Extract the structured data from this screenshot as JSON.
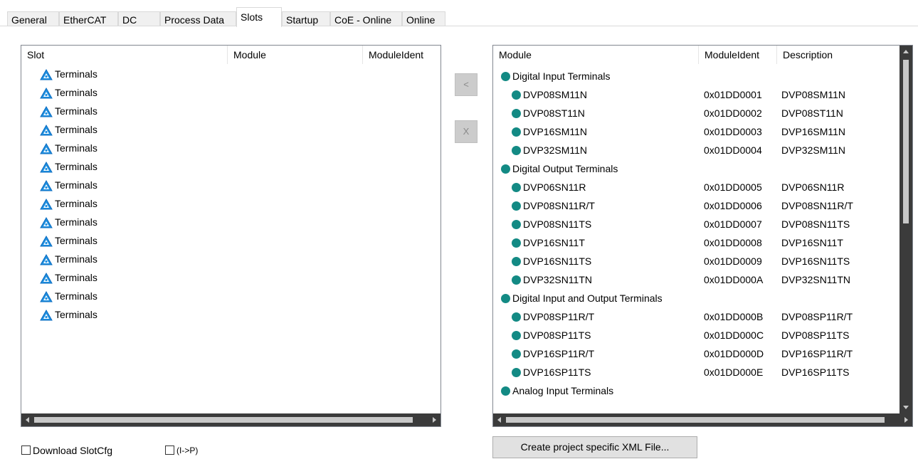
{
  "tabs": [
    "General",
    "EtherCAT",
    "DC",
    "Process Data",
    "Slots",
    "Startup",
    "CoE - Online",
    "Online"
  ],
  "active_tab": "Slots",
  "slot_table": {
    "headers": [
      "Slot",
      "Module",
      "ModuleIdent"
    ],
    "rows": [
      "Terminals",
      "Terminals",
      "Terminals",
      "Terminals",
      "Terminals",
      "Terminals",
      "Terminals",
      "Terminals",
      "Terminals",
      "Terminals",
      "Terminals",
      "Terminals",
      "Terminals",
      "Terminals"
    ],
    "row_icon": "warning-triangle-icon"
  },
  "buttons": {
    "insert": "<",
    "remove": "X",
    "create_xml": "Create project specific XML File..."
  },
  "module_table": {
    "headers": [
      "Module",
      "ModuleIdent",
      "Description"
    ],
    "rows": [
      {
        "name": "Digital Input Terminals",
        "ident": "",
        "desc": "",
        "group": true
      },
      {
        "name": "DVP08SM11N",
        "ident": "0x01DD0001",
        "desc": "DVP08SM11N",
        "group": false
      },
      {
        "name": "DVP08ST11N",
        "ident": "0x01DD0002",
        "desc": "DVP08ST11N",
        "group": false
      },
      {
        "name": "DVP16SM11N",
        "ident": "0x01DD0003",
        "desc": "DVP16SM11N",
        "group": false
      },
      {
        "name": "DVP32SM11N",
        "ident": "0x01DD0004",
        "desc": "DVP32SM11N",
        "group": false
      },
      {
        "name": "Digital Output Terminals",
        "ident": "",
        "desc": "",
        "group": true
      },
      {
        "name": "DVP06SN11R",
        "ident": "0x01DD0005",
        "desc": "DVP06SN11R",
        "group": false
      },
      {
        "name": "DVP08SN11R/T",
        "ident": "0x01DD0006",
        "desc": "DVP08SN11R/T",
        "group": false
      },
      {
        "name": "DVP08SN11TS",
        "ident": "0x01DD0007",
        "desc": "DVP08SN11TS",
        "group": false
      },
      {
        "name": "DVP16SN11T",
        "ident": "0x01DD0008",
        "desc": "DVP16SN11T",
        "group": false
      },
      {
        "name": "DVP16SN11TS",
        "ident": "0x01DD0009",
        "desc": "DVP16SN11TS",
        "group": false
      },
      {
        "name": "DVP32SN11TN",
        "ident": "0x01DD000A",
        "desc": "DVP32SN11TN",
        "group": false
      },
      {
        "name": "Digital Input and Output Terminals",
        "ident": "",
        "desc": "",
        "group": true
      },
      {
        "name": "DVP08SP11R/T",
        "ident": "0x01DD000B",
        "desc": "DVP08SP11R/T",
        "group": false
      },
      {
        "name": "DVP08SP11TS",
        "ident": "0x01DD000C",
        "desc": "DVP08SP11TS",
        "group": false
      },
      {
        "name": "DVP16SP11R/T",
        "ident": "0x01DD000D",
        "desc": "DVP16SP11R/T",
        "group": false
      },
      {
        "name": "DVP16SP11TS",
        "ident": "0x01DD000E",
        "desc": "DVP16SP11TS",
        "group": false
      },
      {
        "name": "Analog Input Terminals",
        "ident": "",
        "desc": "",
        "group": true
      }
    ],
    "row_icon": "teal-dot-icon",
    "icon_color": "#138a84"
  },
  "checkboxes": [
    {
      "label": "Download SlotCfg",
      "checked": false
    },
    {
      "label": "(I->P)",
      "checked": false
    }
  ]
}
